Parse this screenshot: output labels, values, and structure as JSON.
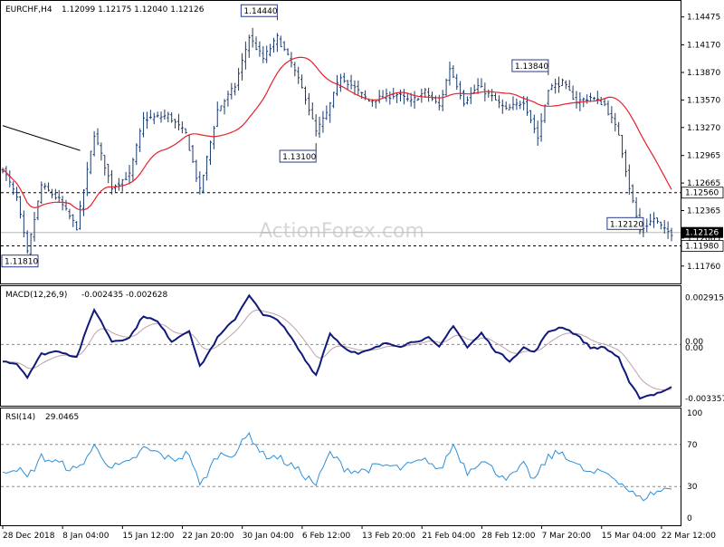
{
  "chart_data": [
    {
      "type": "candlestick",
      "header": {
        "symbol": "EURCHF,H4",
        "ohlc": "1.12099 1.12175 1.12040 1.12126"
      },
      "ylim": [
        1.116,
        1.1462
      ],
      "yticks": [
        "1.14475",
        "1.14170",
        "1.13870",
        "1.13570",
        "1.13270",
        "1.12965",
        "1.12665",
        "1.12365",
        "1.12065",
        "1.11760"
      ],
      "ytick_values": [
        1.14475,
        1.1417,
        1.1387,
        1.1357,
        1.1327,
        1.12965,
        1.12665,
        1.12365,
        1.12065,
        1.1176
      ],
      "x_dates": [
        "28 Dec 2018",
        "8 Jan 04:00",
        "15 Jan 12:00",
        "22 Jan 20:00",
        "30 Jan 04:00",
        "6 Feb 12:00",
        "13 Feb 20:00",
        "21 Feb 04:00",
        "28 Feb 12:00",
        "7 Mar 20:00",
        "15 Mar 04:00",
        "22 Mar 12:00"
      ],
      "current_price": {
        "value": 1.12126,
        "label": "1.12126"
      },
      "levels": [
        {
          "value": 1.1256,
          "label": "1.12560"
        },
        {
          "value": 1.1198,
          "label": "1.11980"
        }
      ],
      "callouts": [
        {
          "label": "1.14440",
          "value": 1.1444,
          "bar": 78
        },
        {
          "label": "1.13840",
          "value": 1.1384,
          "bar": 155
        },
        {
          "label": "1.13100",
          "value": 1.131,
          "bar": 89
        },
        {
          "label": "1.12120",
          "value": 1.1212,
          "bar": 182
        },
        {
          "label": "1.11810",
          "value": 1.1181,
          "bar": 7
        }
      ],
      "trendline": [
        {
          "bar": 0,
          "value": 1.1329
        },
        {
          "bar": 22,
          "value": 1.1302
        }
      ],
      "ma_color": "#e8202a",
      "bar_color": "#1a3a6b",
      "watermark": "ActionForex.com",
      "anchors": [
        [
          0,
          1.1282
        ],
        [
          4,
          1.125
        ],
        [
          7,
          1.119
        ],
        [
          11,
          1.1264
        ],
        [
          16,
          1.1248
        ],
        [
          21,
          1.1218
        ],
        [
          26,
          1.132
        ],
        [
          31,
          1.1262
        ],
        [
          36,
          1.1275
        ],
        [
          40,
          1.1336
        ],
        [
          47,
          1.134
        ],
        [
          52,
          1.132
        ],
        [
          56,
          1.1258
        ],
        [
          61,
          1.1346
        ],
        [
          66,
          1.1372
        ],
        [
          70,
          1.1426
        ],
        [
          74,
          1.1402
        ],
        [
          78,
          1.1425
        ],
        [
          82,
          1.1397
        ],
        [
          86,
          1.136
        ],
        [
          89,
          1.1322
        ],
        [
          92,
          1.1342
        ],
        [
          96,
          1.1383
        ],
        [
          100,
          1.137
        ],
        [
          104,
          1.1356
        ],
        [
          108,
          1.136
        ],
        [
          112,
          1.1363
        ],
        [
          116,
          1.1355
        ],
        [
          120,
          1.1366
        ],
        [
          124,
          1.135
        ],
        [
          127,
          1.1392
        ],
        [
          131,
          1.1355
        ],
        [
          135,
          1.1372
        ],
        [
          139,
          1.136
        ],
        [
          143,
          1.1346
        ],
        [
          148,
          1.1356
        ],
        [
          152,
          1.1316
        ],
        [
          155,
          1.137
        ],
        [
          159,
          1.1376
        ],
        [
          163,
          1.1355
        ],
        [
          167,
          1.136
        ],
        [
          171,
          1.1352
        ],
        [
          175,
          1.132
        ],
        [
          178,
          1.1262
        ],
        [
          181,
          1.1214
        ],
        [
          185,
          1.1228
        ],
        [
          188,
          1.1215
        ],
        [
          190,
          1.1212
        ]
      ]
    },
    {
      "type": "line",
      "header": {
        "name": "MACD(12,26,9)",
        "values": "-0.002435 -0.002628"
      },
      "ylim": [
        -0.0037,
        0.0034
      ],
      "yticks": [
        "0.002915",
        "0.00",
        "0.00",
        "-0.003357"
      ],
      "ytick_values": [
        0.002915,
        0.0002,
        -0.0002,
        -0.003357
      ],
      "zero_line": 0,
      "macd_color": "#101a7a",
      "signal_color": "#c0a0a8",
      "anchors": [
        [
          0,
          -0.001
        ],
        [
          4,
          -0.0012
        ],
        [
          7,
          -0.002
        ],
        [
          11,
          -0.0006
        ],
        [
          16,
          -0.0004
        ],
        [
          21,
          -0.0008
        ],
        [
          26,
          0.0022
        ],
        [
          31,
          0.0002
        ],
        [
          36,
          0.0004
        ],
        [
          40,
          0.0018
        ],
        [
          44,
          0.0014
        ],
        [
          48,
          0.0002
        ],
        [
          53,
          0.0009
        ],
        [
          56,
          -0.0014
        ],
        [
          61,
          0.0004
        ],
        [
          66,
          0.0016
        ],
        [
          70,
          0.0031
        ],
        [
          74,
          0.0018
        ],
        [
          78,
          0.0016
        ],
        [
          82,
          0.0004
        ],
        [
          86,
          -0.001
        ],
        [
          89,
          -0.0019
        ],
        [
          93,
          0.0007
        ],
        [
          97,
          -0.0002
        ],
        [
          101,
          -0.0006
        ],
        [
          105,
          -0.0003
        ],
        [
          109,
          0.0001
        ],
        [
          113,
          -0.0001
        ],
        [
          117,
          0.0002
        ],
        [
          121,
          0.0004
        ],
        [
          124,
          -0.0002
        ],
        [
          128,
          0.0012
        ],
        [
          132,
          -0.0002
        ],
        [
          136,
          0.0007
        ],
        [
          140,
          -0.0004
        ],
        [
          144,
          -0.001
        ],
        [
          148,
          -0.0002
        ],
        [
          151,
          -0.0005
        ],
        [
          155,
          0.0008
        ],
        [
          159,
          0.0011
        ],
        [
          163,
          0.0006
        ],
        [
          167,
          -0.0002
        ],
        [
          171,
          -0.0002
        ],
        [
          175,
          -0.0008
        ],
        [
          178,
          -0.0024
        ],
        [
          181,
          -0.0033
        ],
        [
          185,
          -0.0031
        ],
        [
          190,
          -0.0027
        ]
      ]
    },
    {
      "type": "line",
      "header": {
        "name": "RSI(14)",
        "values": "29.0465"
      },
      "ylim": [
        0,
        100
      ],
      "yticks": [
        "100",
        "70",
        "30",
        "0"
      ],
      "ytick_values": [
        100,
        70,
        30,
        0
      ],
      "levels": [
        70,
        30
      ],
      "rsi_color": "#2e8fd6",
      "anchors": [
        [
          0,
          45
        ],
        [
          4,
          48
        ],
        [
          7,
          38
        ],
        [
          11,
          58
        ],
        [
          16,
          52
        ],
        [
          21,
          45
        ],
        [
          26,
          68
        ],
        [
          31,
          48
        ],
        [
          36,
          52
        ],
        [
          40,
          66
        ],
        [
          44,
          62
        ],
        [
          48,
          55
        ],
        [
          53,
          62
        ],
        [
          56,
          30
        ],
        [
          61,
          60
        ],
        [
          66,
          62
        ],
        [
          70,
          80
        ],
        [
          74,
          60
        ],
        [
          78,
          58
        ],
        [
          82,
          50
        ],
        [
          86,
          40
        ],
        [
          89,
          32
        ],
        [
          93,
          62
        ],
        [
          97,
          48
        ],
        [
          101,
          44
        ],
        [
          105,
          48
        ],
        [
          109,
          50
        ],
        [
          113,
          47
        ],
        [
          117,
          52
        ],
        [
          121,
          55
        ],
        [
          124,
          44
        ],
        [
          128,
          70
        ],
        [
          132,
          44
        ],
        [
          136,
          56
        ],
        [
          140,
          44
        ],
        [
          144,
          38
        ],
        [
          148,
          50
        ],
        [
          151,
          36
        ],
        [
          155,
          58
        ],
        [
          159,
          63
        ],
        [
          163,
          50
        ],
        [
          167,
          42
        ],
        [
          171,
          44
        ],
        [
          175,
          36
        ],
        [
          178,
          26
        ],
        [
          181,
          18
        ],
        [
          185,
          24
        ],
        [
          190,
          29
        ]
      ]
    }
  ]
}
